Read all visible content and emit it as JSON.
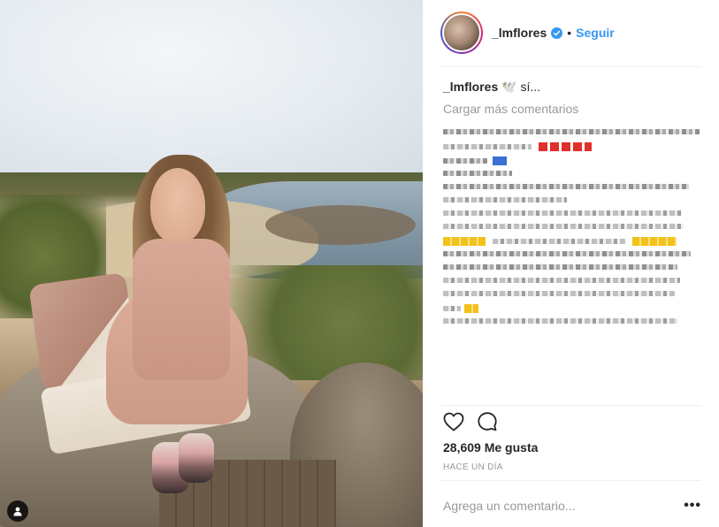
{
  "post": {
    "username": "_lmflores",
    "follow_label": "Seguir",
    "separator_dot": "•",
    "caption_username": "_lmflores",
    "caption_text": "🕊️ sí...",
    "load_more_label": "Cargar más comentarios",
    "likes_text": "28,609 Me gusta",
    "time_text": "HACE UN DÍA",
    "comment_placeholder": "Agrega un comentario...",
    "more_options_label": "•••"
  },
  "icons": {
    "verified": "verified-badge-icon",
    "like": "heart-icon",
    "comment": "comment-bubble-icon",
    "tag": "user-tag-icon",
    "options": "ellipsis-icon"
  },
  "colors": {
    "accent": "#3897f0",
    "text": "#262626",
    "muted": "#999999",
    "divider": "#efefef"
  }
}
